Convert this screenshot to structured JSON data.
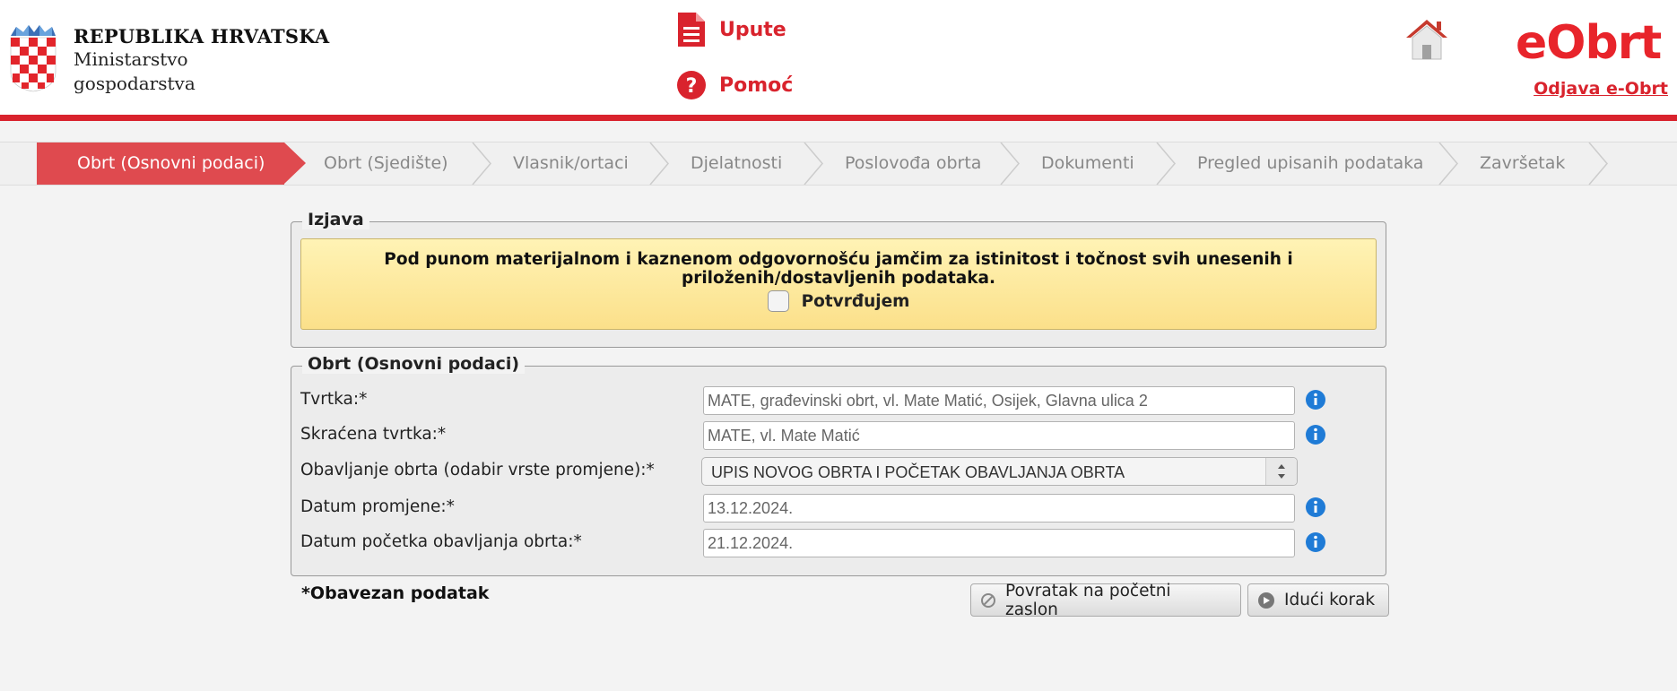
{
  "header": {
    "republic": "REPUBLIKA HRVATSKA",
    "ministry_line1": "Ministarstvo",
    "ministry_line2": "gospodarstva",
    "upute": "Upute",
    "pomoc": "Pomoć",
    "brand": "eObrt",
    "logout": "Odjava e-Obrt"
  },
  "steps": [
    {
      "label": "Obrt (Osnovni podaci)",
      "active": true
    },
    {
      "label": "Obrt (Sjedište)",
      "active": false
    },
    {
      "label": "Vlasnik/ortaci",
      "active": false
    },
    {
      "label": "Djelatnosti",
      "active": false
    },
    {
      "label": "Poslovođa obrta",
      "active": false
    },
    {
      "label": "Dokumenti",
      "active": false
    },
    {
      "label": "Pregled upisanih podataka",
      "active": false
    },
    {
      "label": "Završetak",
      "active": false
    }
  ],
  "izjava": {
    "legend": "Izjava",
    "text_line1": "Pod punom materijalnom i kaznenom odgovornošću jamčim za istinitost i točnost svih unesenih i",
    "text_line2": "priloženih/dostavljenih podataka.",
    "confirm_label": "Potvrđujem",
    "confirm_checked": false
  },
  "basic": {
    "legend": "Obrt (Osnovni podaci)",
    "fields": [
      {
        "label": "Tvrtka:*",
        "value": "MATE, građevinski obrt, vl. Mate Matić, Osijek, Glavna ulica 2"
      },
      {
        "label": "Skraćena tvrtka:*",
        "value": "MATE, vl. Mate Matić"
      },
      {
        "label": "Obavljanje obrta (odabir vrste promjene):*",
        "value": "UPIS NOVOG OBRTA I POČETAK OBAVLJANJA OBRTA"
      },
      {
        "label": "Datum promjene:*",
        "value": "13.12.2024."
      },
      {
        "label": "Datum početka obavljanja obrta:*",
        "value": "21.12.2024."
      }
    ]
  },
  "footer": {
    "mandatory": "*Obavezan podatak",
    "back_button": "Povratak na početni zaslon",
    "next_button": "Idući korak"
  },
  "colors": {
    "accent_red": "#d9232d",
    "active_step": "#df4a4f",
    "info_blue": "#1f7bd6"
  },
  "icons": [
    "coat-of-arms-icon",
    "document-icon",
    "question-icon",
    "home-icon",
    "info-icon",
    "cancel-icon",
    "arrow-right-icon"
  ]
}
